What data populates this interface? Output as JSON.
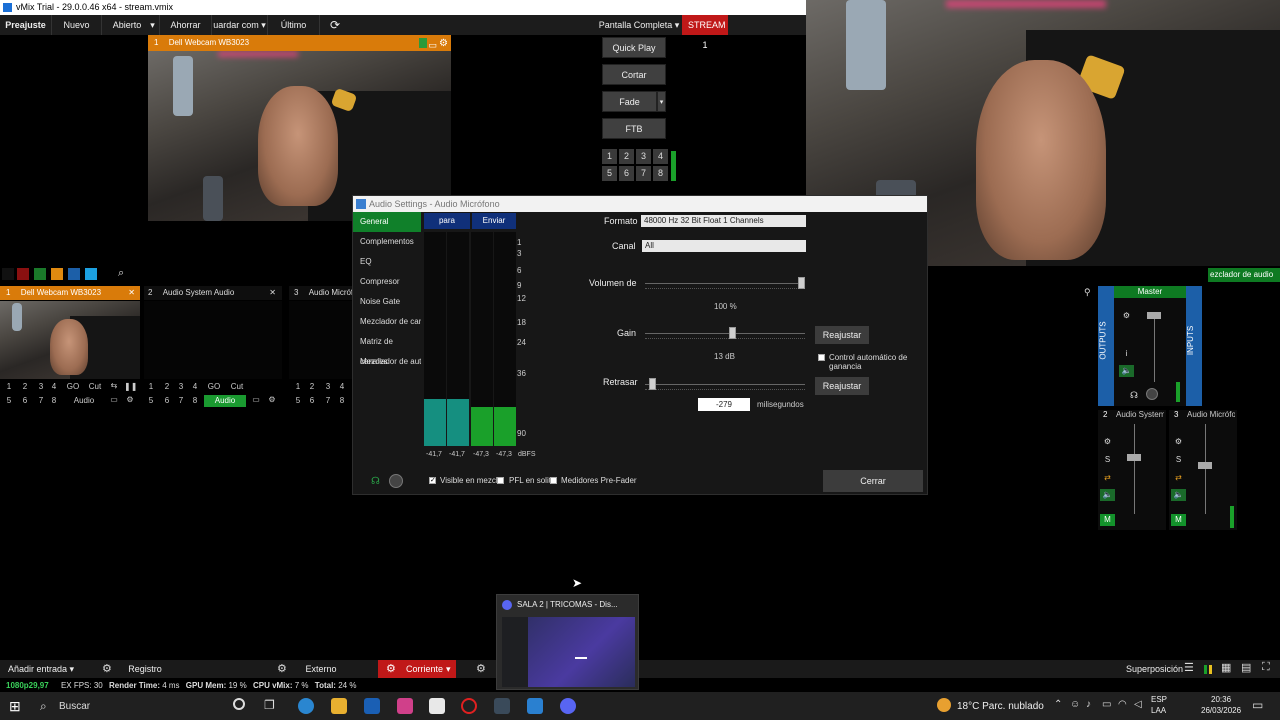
{
  "window": {
    "title": "vMix Trial - 29.0.0.46 x64 - stream.vmix"
  },
  "menu": {
    "preajuste": "Preajuste",
    "nuevo": "Nuevo",
    "abierto": "Abierto",
    "ahorrar": "Ahorrar",
    "guardar_como": "uardar com",
    "ultimo": "Último",
    "pantalla_completa": "Pantalla Completa",
    "stream": "STREAM 1"
  },
  "preview": {
    "number": "1",
    "title": "Dell Webcam WB3023"
  },
  "transitions": {
    "quick_play": "Quick Play",
    "cortar": "Cortar",
    "fade": "Fade",
    "ftb": "FTB",
    "numbers": [
      "1",
      "2",
      "3",
      "4",
      "5",
      "6",
      "7",
      "8"
    ]
  },
  "inputs": [
    {
      "number": "1",
      "title": "Dell Webcam WB3023",
      "active": true,
      "row1": [
        "1",
        "2",
        "3",
        "4",
        "GO",
        "Cut"
      ],
      "row2": [
        "5",
        "6",
        "7",
        "8",
        "Audio"
      ]
    },
    {
      "number": "2",
      "title": "Audio System Audio",
      "active": false,
      "row1": [
        "1",
        "2",
        "3",
        "4",
        "GO",
        "Cut"
      ],
      "row2": [
        "5",
        "6",
        "7",
        "8",
        "Audio"
      ]
    },
    {
      "number": "3",
      "title": "Audio Micrófono",
      "active": false,
      "row1": [
        "1",
        "2",
        "3",
        "4"
      ],
      "row2": [
        "5",
        "6",
        "7",
        "8"
      ]
    }
  ],
  "dialog": {
    "title": "Audio Settings - Audio Micrófono",
    "menu": [
      "General",
      "Complementos",
      "EQ",
      "Compresor",
      "Noise Gate",
      "Mezclador de cana",
      "Matriz de canales",
      "Mezclador de autob"
    ],
    "meter_tabs": {
      "para": "para",
      "enviar": "Enviar"
    },
    "scale": [
      "1",
      "3",
      "6",
      "9",
      "12",
      "18",
      "24",
      "36",
      "90"
    ],
    "meter_values": [
      "-41,7",
      "-41,7",
      "-47,3",
      "-47,3"
    ],
    "meter_unit": "dBFS",
    "meter_levels": [
      0.22,
      0.22,
      0.18,
      0.18
    ],
    "formato_label": "Formato",
    "formato_value": "48000 Hz 32 Bit Float 1 Channels",
    "canal_label": "Canal",
    "canal_value": "All",
    "volumen_label": "Volumen de",
    "volumen_value": "100 %",
    "volumen_level": 1.0,
    "gain_label": "Gain",
    "gain_value": "13 dB",
    "gain_level": 0.55,
    "reajustar1": "Reajustar",
    "auto_gain": "Control automático de ganancia",
    "retrasar_label": "Retrasar",
    "retrasar_value": "-279",
    "retrasar_unit": "milisegundos",
    "reajustar2": "Reajustar",
    "visible": "Visible en mezcla",
    "pfl": "PFL en solita",
    "pre_fader": "Medidores Pre-Fader",
    "cerrar": "Cerrar"
  },
  "mixer": {
    "label": "ezclador de audio",
    "master": "Master",
    "outputs": "OUTPUTS",
    "inputs": "INPUTS",
    "strip2": "Audio System A",
    "strip2_num": "2",
    "strip3": "Audio Micrófono",
    "strip3_num": "3",
    "s": "S",
    "m": "M"
  },
  "bottom": {
    "anadir": "Añadir entrada",
    "registro": "Registro",
    "externo": "Externo",
    "corriente": "Corriente",
    "superposicion": "Superposición"
  },
  "status": {
    "res": "1080p29,97",
    "fps_label": "EX  FPS:",
    "fps": "30",
    "render_label": "Render Time:",
    "render": "4 ms",
    "gpu_label": "GPU Mem:",
    "gpu": "19 %",
    "cpu_label": "CPU vMix:",
    "cpu": "7 %",
    "total_label": "Total:",
    "total": "24 %"
  },
  "discord": {
    "title": "SALA 2 | TRICOMAS - Dis..."
  },
  "taskbar": {
    "search": "Buscar",
    "weather": "18°C  Parc. nublado",
    "lang1": "ESP",
    "lang2": "LAA",
    "time": "20:36",
    "date": "26/03/2026"
  },
  "colors": {
    "orange": "#d97b0a",
    "green": "#10802a",
    "red": "#c01818",
    "blue": "#1c5fa8"
  }
}
